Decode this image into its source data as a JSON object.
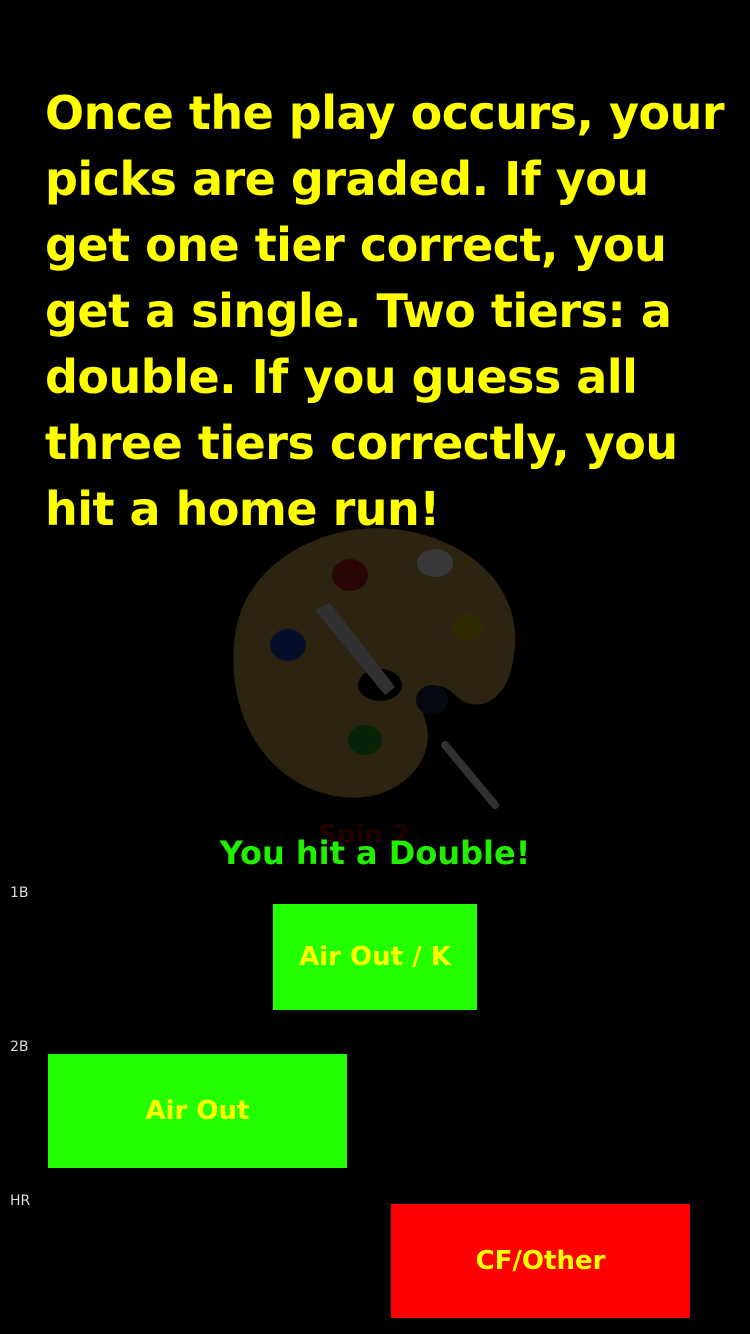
{
  "instruction": {
    "text": "Once the play occurs, your picks are graded.  If you get one tier correct, you get a single. Two tiers: a double. If you guess all three tiers correctly, you hit a home run!"
  },
  "background_art": {
    "icon": "paint-palette-icon",
    "colors": {
      "palette": "#c9a64a",
      "paint_red": "#c01818",
      "paint_blue": "#2040c0",
      "paint_yellow": "#e0c000",
      "paint_green": "#20a020",
      "paint_navy": "#1a2050",
      "paint_white": "#ffffff"
    },
    "faded_label": "Spin 2"
  },
  "result": {
    "text": "You hit a Double!",
    "color": "#22ee00"
  },
  "tiers": [
    {
      "label": "1B",
      "pick": "Air Out / K",
      "status": "correct",
      "color": "#22ff00"
    },
    {
      "label": "2B",
      "pick": "Air Out",
      "status": "correct",
      "color": "#22ff00"
    },
    {
      "label": "HR",
      "pick": "CF/Other",
      "status": "wrong",
      "color": "#ff0000"
    }
  ]
}
